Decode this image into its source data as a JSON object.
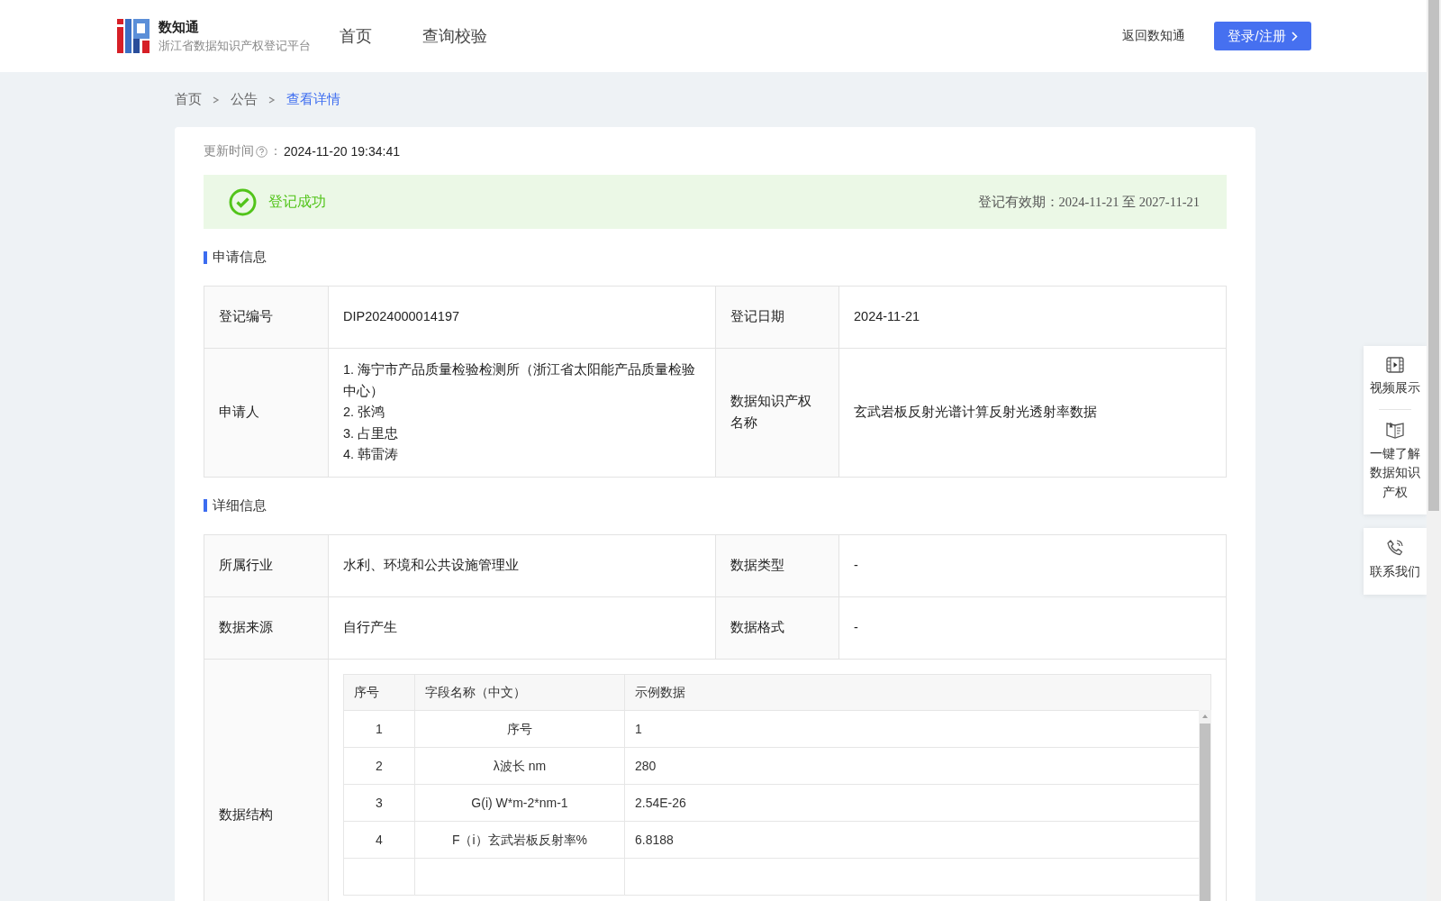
{
  "header": {
    "logo_title": "数知通",
    "logo_subtitle": "浙江省数据知识产权登记平台",
    "nav": [
      {
        "label": "首页",
        "selected": false
      },
      {
        "label": "查询校验",
        "selected": false
      }
    ],
    "back_link": "返回数知通",
    "login_button": "登录/注册"
  },
  "breadcrumb": [
    {
      "label": "首页",
      "selected": false
    },
    {
      "label": "公告",
      "selected": false
    },
    {
      "label": "查看详情",
      "selected": true
    }
  ],
  "update_time": {
    "label": "更新时间",
    "colon": "：",
    "value": "2024-11-20 19:34:41"
  },
  "status": {
    "kind": "success",
    "text": "登记成功",
    "validity": "登记有效期：2024-11-21 至 2027-11-21"
  },
  "sections": [
    {
      "title": "申请信息",
      "rows": [
        {
          "kind": "pair",
          "fields": [
            {
              "label": "登记编号",
              "lines": [
                "DIP2024000014197"
              ]
            },
            {
              "label": "登记日期",
              "lines": [
                "2024-11-21"
              ]
            }
          ]
        },
        {
          "kind": "pair",
          "fields": [
            {
              "label": "申请人",
              "lines": [
                "1. 海宁市产品质量检验检测所（浙江省太阳能产品质量检验中心）",
                "2. 张鸿",
                "3. 占里忠",
                "4. 韩雷涛"
              ]
            },
            {
              "label": "数据知识产权名称",
              "lines": [
                "玄武岩板反射光谱计算反射光透射率数据"
              ]
            }
          ]
        }
      ]
    },
    {
      "title": "详细信息",
      "rows": [
        {
          "kind": "pair",
          "fields": [
            {
              "label": "所属行业",
              "lines": [
                "水利、环境和公共设施管理业"
              ]
            },
            {
              "label": "数据类型",
              "lines": [
                "-"
              ]
            }
          ]
        },
        {
          "kind": "pair",
          "fields": [
            {
              "label": "数据来源",
              "lines": [
                "自行产生"
              ]
            },
            {
              "label": "数据格式",
              "lines": [
                "-"
              ]
            }
          ]
        },
        {
          "kind": "schema",
          "label": "数据结构",
          "columns": [
            "序号",
            "字段名称（中文）",
            "示例数据"
          ],
          "rows": [
            [
              "1",
              "序号",
              "1"
            ],
            [
              "2",
              "λ波长 nm",
              "280"
            ],
            [
              "3",
              "G(i) W*m-2*nm-1",
              "2.54E-26"
            ],
            [
              "4",
              "F（i）玄武岩板反射率%",
              "6.8188"
            ]
          ]
        }
      ]
    }
  ],
  "side_panel": {
    "groups": [
      [
        {
          "kind": "video",
          "label": "视频展示"
        },
        {
          "kind": "book",
          "label": "一键了解数据知识产权"
        }
      ],
      [
        {
          "kind": "phone",
          "label": "联系我们"
        }
      ]
    ]
  }
}
